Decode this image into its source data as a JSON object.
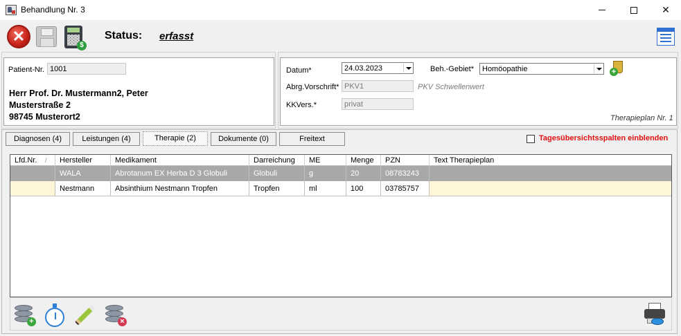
{
  "window": {
    "title": "Behandlung Nr. 3"
  },
  "toolbar": {
    "status_label": "Status:",
    "status_value": "erfasst"
  },
  "patient": {
    "nr_label": "Patient-Nr.",
    "nr_value": "1001",
    "name": "Herr Prof. Dr. Mustermann2, Peter",
    "street": "Musterstraße 2",
    "city": "98745 Musterort2"
  },
  "meta": {
    "datum_label": "Datum*",
    "datum_value": "24.03.2023",
    "gebiet_label": "Beh.-Gebiet*",
    "gebiet_value": "Homöopathie",
    "abrg_label": "Abrg.Vorschrift*",
    "abrg_value": "PKV1",
    "abrg_hint": "PKV Schwellenwert",
    "kkvers_label": "KKVers.*",
    "kkvers_value": "privat",
    "plan_label": "Therapieplan Nr. 1"
  },
  "tabs": [
    {
      "label": "Diagnosen (4)"
    },
    {
      "label": "Leistungen (4)"
    },
    {
      "label": "Therapie (2)"
    },
    {
      "label": "Dokumente (0)"
    },
    {
      "label": "Freitext"
    }
  ],
  "options": {
    "tages_label": "Tagesübersichtsspalten einblenden"
  },
  "grid": {
    "columns": [
      "Lfd.Nr.",
      "Hersteller",
      "Medikament",
      "Darreichung",
      "ME",
      "Menge",
      "PZN",
      "Text Therapieplan"
    ],
    "rows": [
      [
        "",
        "WALA",
        "Abrotanum EX Herba D 3 Globuli",
        "Globuli",
        "g",
        "20",
        "08783243",
        ""
      ],
      [
        "",
        "Nestmann",
        "Absinthium Nestmann Tropfen",
        "Tropfen",
        "ml",
        "100",
        "03785757",
        ""
      ]
    ],
    "sort_indicator": "/"
  },
  "colors": {
    "selected_row": "#a8a8a8",
    "alt_row": "#fff6d8",
    "warning_text": "#e01010",
    "accent": "#2f6fd1"
  },
  "icons": [
    "close-icon",
    "save-icon",
    "calculator-icon",
    "menu-icon",
    "add-cup-icon",
    "db-add-icon",
    "stopwatch-icon",
    "pencil-icon",
    "db-remove-icon",
    "print-preview-icon"
  ]
}
